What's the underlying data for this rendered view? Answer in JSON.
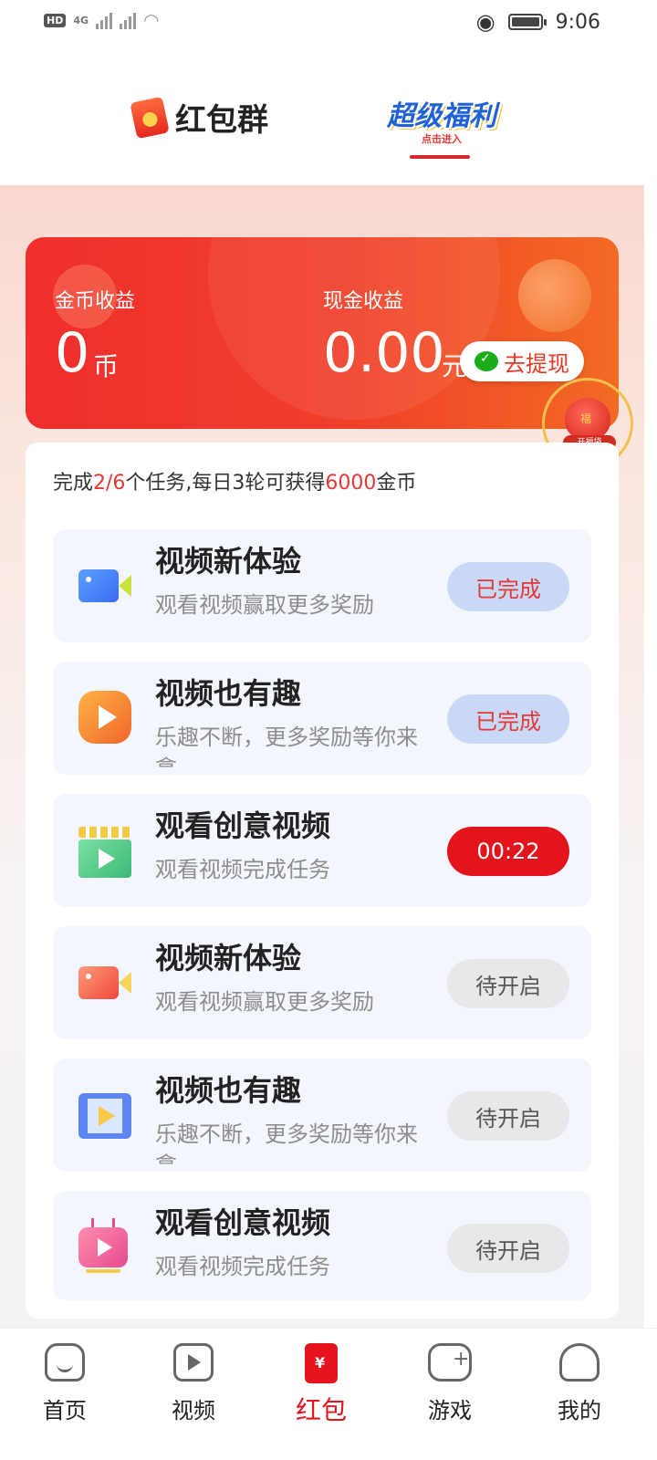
{
  "status_bar": {
    "network": "HD",
    "signal_label": "4G",
    "time": "9:06"
  },
  "top_tabs": {
    "hongbao_group": "红包群",
    "super_welfare": "超级福利",
    "super_welfare_sub": "点击进入"
  },
  "earnings": {
    "coin_label": "金币收益",
    "coin_value": "0",
    "coin_unit": "币",
    "cash_label": "现金收益",
    "cash_value": "0.00",
    "cash_unit": "元",
    "withdraw_label": "去提现"
  },
  "lucky_bag": {
    "label": "开福袋"
  },
  "task_progress": {
    "prefix": "完成",
    "done": "2/6",
    "middle": "个任务,每日3轮可获得",
    "reward": "6000",
    "suffix": "金币"
  },
  "tasks": [
    {
      "title": "视频新体验",
      "desc": "观看视频赢取更多奖励",
      "button": "已完成",
      "icon": "blue-camera-icon"
    },
    {
      "title": "视频也有趣",
      "desc": "乐趣不断，更多奖励等你来拿",
      "button": "已完成",
      "icon": "orange-play-icon"
    },
    {
      "title": "观看创意视频",
      "desc": "观看视频完成任务",
      "button": "00:22",
      "icon": "clapperboard-icon"
    },
    {
      "title": "视频新体验",
      "desc": "观看视频赢取更多奖励",
      "button": "待开启",
      "icon": "red-camera-icon"
    },
    {
      "title": "视频也有趣",
      "desc": "乐趣不断，更多奖励等你来拿",
      "button": "待开启",
      "icon": "film-icon"
    },
    {
      "title": "观看创意视频",
      "desc": "观看视频完成任务",
      "button": "待开启",
      "icon": "tv-icon"
    }
  ],
  "bottom_nav": [
    {
      "label": "首页",
      "icon": "home-icon"
    },
    {
      "label": "视频",
      "icon": "video-icon"
    },
    {
      "label": "红包",
      "icon": "red-envelope-icon",
      "active": true
    },
    {
      "label": "游戏",
      "icon": "gamepad-icon"
    },
    {
      "label": "我的",
      "icon": "profile-icon"
    }
  ],
  "colors": {
    "accent_red": "#e3141c",
    "done_button_bg": "#c8d8f6",
    "task_card_bg": "#f4f6fd"
  }
}
